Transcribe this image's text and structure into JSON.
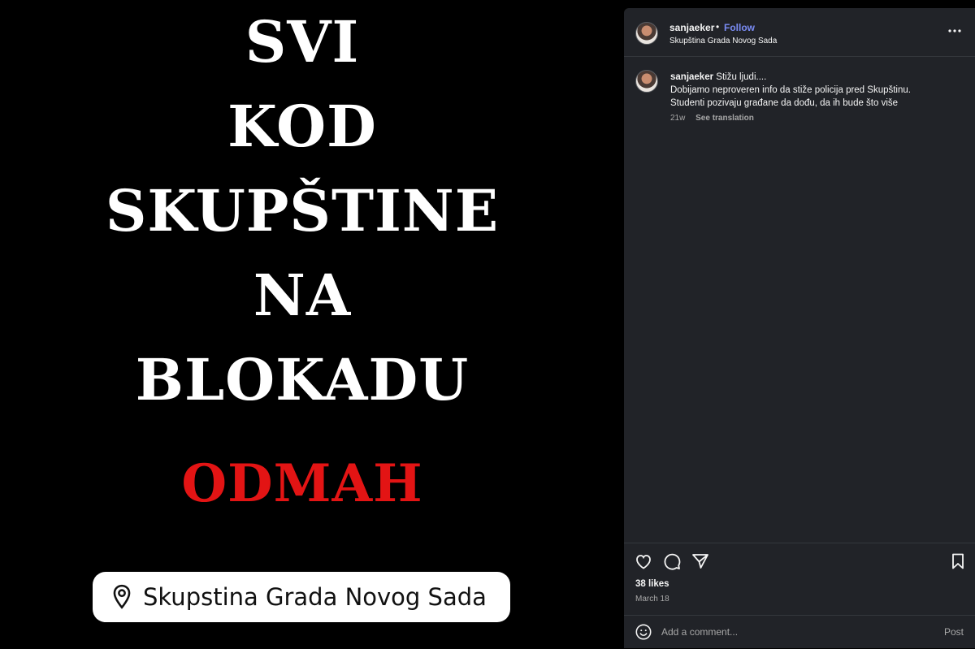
{
  "media": {
    "poster_lines": [
      "SVI",
      "KOD",
      "SKUPŠTINE",
      "NA",
      "BLOKADU"
    ],
    "emphasis_word": "ODMAH",
    "emphasis_color": "#e31414",
    "location_sticker": {
      "icon": "location-pin-icon",
      "text": "Skupstina Grada Novog Sada"
    }
  },
  "post": {
    "header": {
      "username": "sanjaeker",
      "separator": "•",
      "follow_label": "Follow",
      "follow_color": "#7a8cf5",
      "location": "Skupština Grada Novog Sada",
      "more_icon": "more-options-icon"
    },
    "caption": {
      "username": "sanjaeker",
      "lines": [
        "Stižu ljudi....",
        "Dobijamo neproveren info da stiže policija pred Skupštinu.",
        "Studenti pozivaju građane da dođu, da ih bude što više"
      ],
      "age": "21w",
      "see_translation": "See translation"
    },
    "actions": {
      "like_icon": "heart-icon",
      "comment_icon": "comment-bubble-icon",
      "share_icon": "paper-plane-icon",
      "save_icon": "bookmark-icon"
    },
    "likes": "38 likes",
    "date": "March 18",
    "comment_box": {
      "emoji_icon": "smiley-icon",
      "placeholder": "Add a comment...",
      "post_label": "Post"
    },
    "panel_color": "#212328"
  }
}
